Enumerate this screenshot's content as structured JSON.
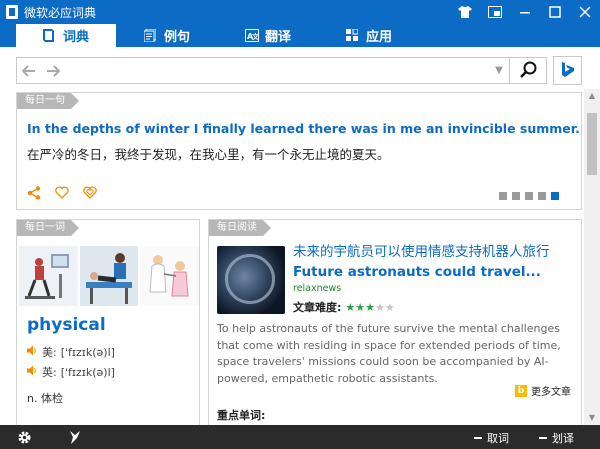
{
  "window": {
    "title": "微软必应词典",
    "controls": {
      "skin": "skin-icon",
      "mini_mode": "mini-mode-icon",
      "minimize": "minimize-icon",
      "maximize": "maximize-icon",
      "close": "close-icon"
    }
  },
  "tabs": [
    {
      "label": "词典",
      "icon": "book-icon",
      "active": true
    },
    {
      "label": "例句",
      "icon": "sentences-icon",
      "active": false
    },
    {
      "label": "翻译",
      "icon": "translate-icon",
      "active": false
    },
    {
      "label": "应用",
      "icon": "apps-icon",
      "active": false
    }
  ],
  "search": {
    "value": "",
    "placeholder": ""
  },
  "daily_sentence": {
    "tag": "每日一句",
    "english": "In the depths of winter I finally learned there was in me an invincible summer.",
    "chinese": "在严冷的冬日，我终于发现，在我心里，有一个永无止境的夏天。",
    "pages": 5,
    "current_page": 5
  },
  "daily_word": {
    "tag": "每日一词",
    "word": "physical",
    "us_label": "美:",
    "us_phonetic": "[ˈfɪzɪk(ə)l]",
    "uk_label": "英:",
    "uk_phonetic": "[ˈfɪzɪk(ə)l]",
    "definition": "n. 体检"
  },
  "daily_reading": {
    "tag": "每日阅读",
    "title_cn": "未来的宇航员可以使用情感支持机器人旅行",
    "title_en": "Future astronauts could travel...",
    "source": "relaxnews",
    "difficulty_label": "文章难度:",
    "difficulty": 3,
    "difficulty_max": 5,
    "summary": "To help astronauts of the future survive the mental challenges that come with residing in space for extended periods of time, space travelers' missions could soon be accompanied by AI-powered, empathetic robotic assistants.",
    "more_label": "更多文章",
    "key_words_label": "重点单词:"
  },
  "bottom_bar": {
    "settings_icon": "gear-icon",
    "feedback_icon": "feedback-icon",
    "pick_word_label": "取词",
    "select_translate_label": "划译"
  },
  "colors": {
    "brand_blue": "#0c6bc4",
    "accent_orange": "#f08c00",
    "source_green": "#1f8b2b",
    "bottom_bar": "#2b2b2b"
  }
}
